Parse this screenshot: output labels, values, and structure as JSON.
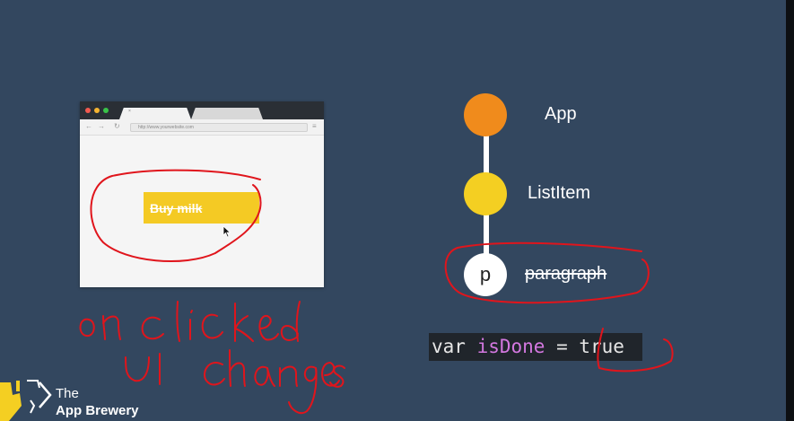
{
  "browser": {
    "tab_label": "×",
    "url": "http://www.yourwebsite.com",
    "button_label": "Buy milk",
    "nav": {
      "back": "←",
      "forward": "→",
      "reload": "↻",
      "menu": "≡"
    }
  },
  "tree": {
    "nodes": [
      {
        "label": "App",
        "color": "#f08b1c",
        "letter": ""
      },
      {
        "label": "ListItem",
        "color": "#f4cf22",
        "letter": ""
      },
      {
        "label": "paragraph",
        "color": "#ffffff",
        "letter": "p",
        "struck_through": true
      }
    ]
  },
  "code": {
    "keyword": "var ",
    "variable": "isDone",
    "operator": " = ",
    "value": "true"
  },
  "annotations": {
    "color": "#e0151c",
    "handwriting": "on clicked UI changes"
  },
  "logo": {
    "line1": "The",
    "line2": "App Brewery"
  }
}
